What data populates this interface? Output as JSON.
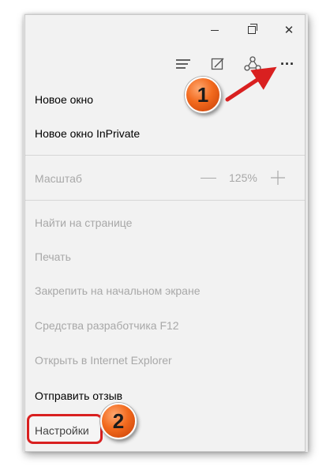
{
  "menu": {
    "items": [
      {
        "label": "Новое окно",
        "enabled": true
      },
      {
        "label": "Новое окно InPrivate",
        "enabled": true
      },
      {
        "label": "Масштаб",
        "enabled": false
      },
      {
        "label": "Найти на странице",
        "enabled": false
      },
      {
        "label": "Печать",
        "enabled": false
      },
      {
        "label": "Закрепить на начальном экране",
        "enabled": false
      },
      {
        "label": "Средства разработчика F12",
        "enabled": false
      },
      {
        "label": "Открыть в Internet Explorer",
        "enabled": false
      },
      {
        "label": "Отправить отзыв",
        "enabled": true
      },
      {
        "label": "Настройки",
        "enabled": true
      }
    ],
    "zoom": {
      "minus": "—",
      "value": "125%",
      "plus": "+"
    }
  },
  "toolbar": {
    "more_label": "···",
    "icons": [
      "hub-icon",
      "web-note-icon",
      "share-icon",
      "more-icon"
    ]
  },
  "titlebar": {
    "close_glyph": "✕"
  },
  "annotations": {
    "step1": "1",
    "step2": "2",
    "arrow_color": "#d92020",
    "badge_color": "#f26a1e"
  }
}
